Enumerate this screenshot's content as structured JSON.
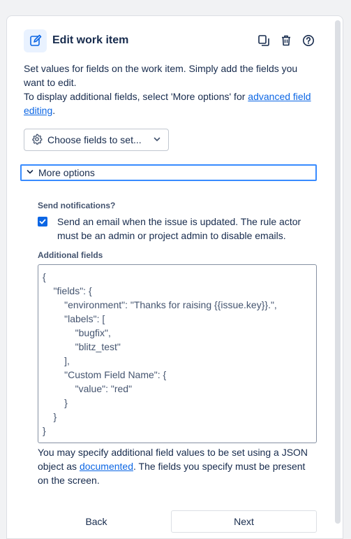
{
  "header": {
    "title": "Edit work item",
    "icon": "edit-icon",
    "actions": [
      {
        "name": "duplicate-icon"
      },
      {
        "name": "trash-icon"
      },
      {
        "name": "help-icon"
      }
    ]
  },
  "description": {
    "line1": "Set values for fields on the work item. Simply add the fields you want to edit.",
    "line2_prefix": "To display additional fields, select 'More options' for ",
    "line2_link": "advanced field editing",
    "line2_suffix": "."
  },
  "choose_fields": {
    "label": "Choose fields to set...",
    "icon": "gear-icon"
  },
  "more_options": {
    "label": "More options",
    "expanded": true
  },
  "send_notifications": {
    "label": "Send notifications?",
    "checked": true,
    "text": "Send an email when the issue is updated. The rule actor must be an admin or project admin to disable emails."
  },
  "additional_fields": {
    "label": "Additional fields",
    "lines": [
      "{",
      "    \"fields\": {",
      "        \"environment\": \"Thanks for raising {{issue.key}}.\",",
      "        \"labels\": [",
      "            \"bugfix\",",
      "            \"blitz_test\"",
      "        ],",
      "        \"Custom Field Name\": {",
      "            \"value\": \"red\"",
      "        }",
      "    }",
      "}"
    ]
  },
  "help": {
    "prefix": "You may specify additional field values to be set using a JSON object as ",
    "link": "documented",
    "suffix": ". The fields you specify must be present on the screen."
  },
  "footer": {
    "back_label": "Back",
    "next_label": "Next"
  },
  "colors": {
    "accent": "#0c66e4",
    "focus_border": "#388bff",
    "header_icon_bg": "#e9f2ff"
  }
}
